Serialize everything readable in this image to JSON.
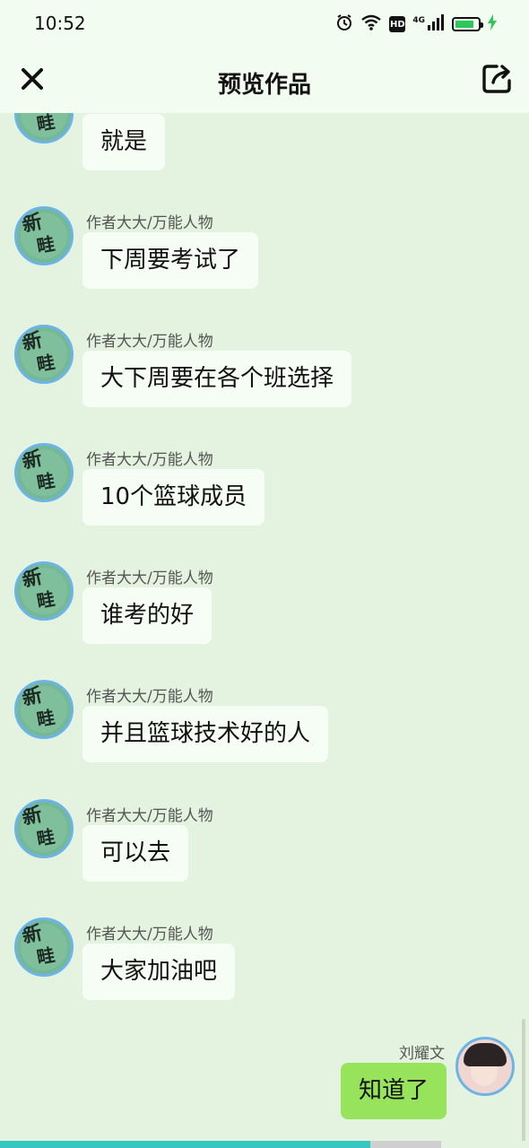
{
  "status_bar": {
    "time": "10:52",
    "signal_label": "4G",
    "hd_label": "HD",
    "battery_level": 0.85,
    "icons": [
      "alarm-icon",
      "wifi-icon",
      "hd-icon",
      "signal-icon",
      "battery-icon",
      "charging-icon"
    ]
  },
  "nav": {
    "title": "预览作品",
    "close_icon": "close-icon",
    "share_icon": "share-icon"
  },
  "avatar_text": {
    "line1": "新",
    "line2": "畦"
  },
  "messages": [
    {
      "sender": "",
      "text": "就是"
    },
    {
      "sender": "作者大大/万能人物",
      "text": "下周要考试了"
    },
    {
      "sender": "作者大大/万能人物",
      "text": "大下周要在各个班选择"
    },
    {
      "sender": "作者大大/万能人物",
      "text": "10个篮球成员"
    },
    {
      "sender": "作者大大/万能人物",
      "text": "谁考的好"
    },
    {
      "sender": "作者大大/万能人物",
      "text": "并且篮球技术好的人"
    },
    {
      "sender": "作者大大/万能人物",
      "text": "可以去"
    },
    {
      "sender": "作者大大/万能人物",
      "text": "大家加油吧"
    }
  ],
  "my_message": {
    "sender": "刘耀文",
    "text": "知道了"
  },
  "progress": {
    "fraction": 0.84
  },
  "colors": {
    "background": "#e4f3df",
    "bar": "#f3fcf0",
    "my_bubble": "#97e35c",
    "their_bubble": "#f6fdf4",
    "avatar_ring": "#6cb4e8",
    "progress": "#36c7c0"
  }
}
